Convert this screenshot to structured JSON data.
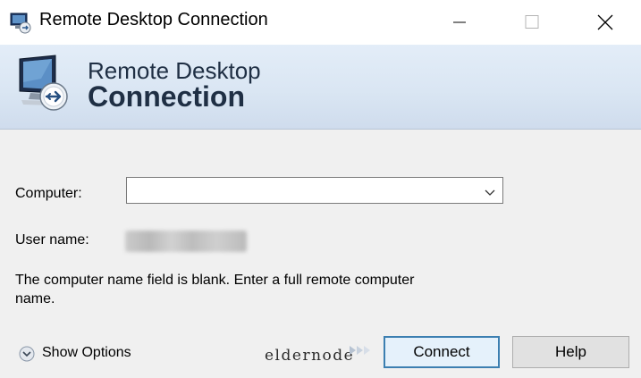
{
  "window": {
    "title": "Remote Desktop Connection"
  },
  "banner": {
    "line1": "Remote Desktop",
    "line2": "Connection"
  },
  "form": {
    "computer_label": "Computer:",
    "computer_value": "",
    "username_label": "User name:",
    "message": "The computer name field is blank. Enter a full remote computer name."
  },
  "footer": {
    "show_options_label": "Show Options",
    "watermark_text": "eldernode",
    "connect_label": "Connect",
    "help_label": "Help"
  },
  "icons": {
    "app": "remote-desktop-icon",
    "minimize": "minimize-icon",
    "maximize": "maximize-icon",
    "close": "close-icon",
    "dropdown": "chevron-down-icon",
    "options": "chevron-circle-down-icon"
  },
  "colors": {
    "accent_border": "#3c7fb1",
    "banner_top": "#e3edf8",
    "banner_bottom": "#cfdced",
    "dialog_bg": "#f0f0f0"
  }
}
